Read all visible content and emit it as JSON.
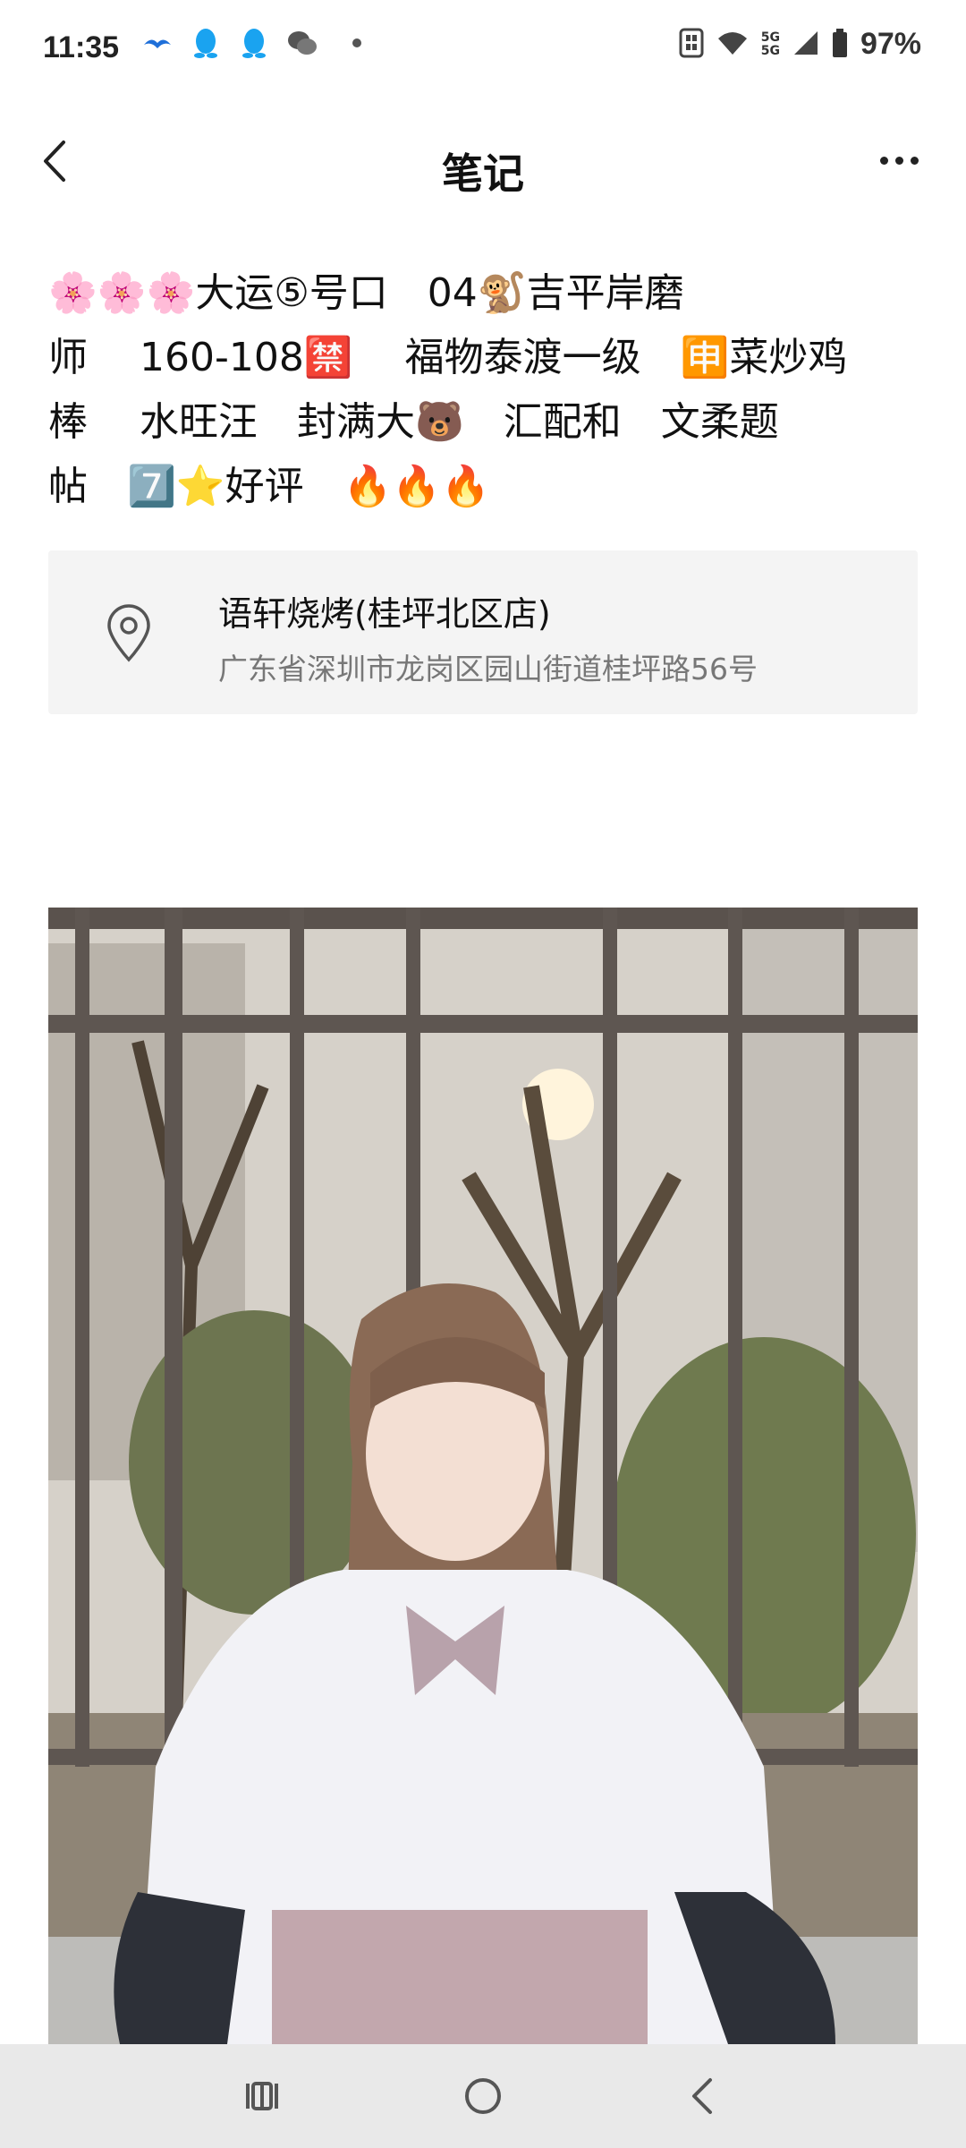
{
  "status_bar": {
    "time": "11:35",
    "apps": [
      "bird-app-icon",
      "qq-icon",
      "qq-icon",
      "wechat-icon"
    ],
    "network": "5G",
    "battery": "97%"
  },
  "header": {
    "title": "笔记"
  },
  "note": {
    "text": "🌸🌸🌸大运⑤号口　04🐒吉平岸磨\n师　 160-108🈲　 福物泰渡一级　🈸菜炒鸡\n棒　 ⽔旺汪　封满大🐻　汇配和　文柔题\n帖　7️⃣⭐好评　🔥🔥🔥"
  },
  "location": {
    "name": "语轩烧烤(桂坪北区店)",
    "address": "广东省深圳市龙岗区园山街道桂坪路56号"
  },
  "colors": {
    "card_bg": "#f4f4f4",
    "nav_bg": "#e9e9e9"
  }
}
